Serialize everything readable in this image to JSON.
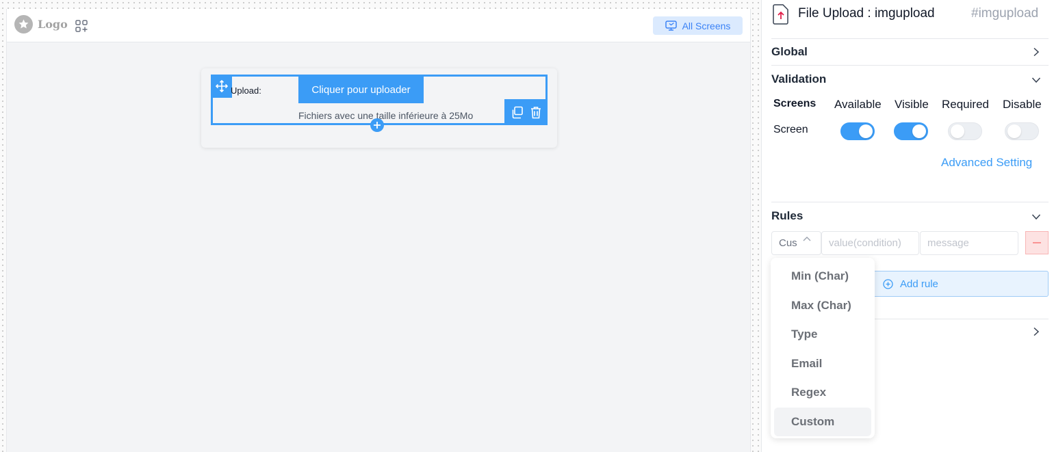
{
  "canvas": {
    "logo_text": "Logo",
    "all_screens_label": "All Screens",
    "component": {
      "label": "Upload:",
      "button_label": "Cliquer pour uploader",
      "hint": "Fichiers avec une taille inférieure à 25Mo"
    }
  },
  "panel": {
    "title": "File Upload : imgupload",
    "id": "#imgupload",
    "sections": {
      "global": "Global",
      "validation": "Validation",
      "rules": "Rules"
    },
    "validation": {
      "columns": [
        "Screens",
        "Available",
        "Visible",
        "Required",
        "Disable"
      ],
      "row_label": "Screen",
      "toggles": {
        "available": true,
        "visible": true,
        "required": false,
        "disable": false
      },
      "advanced_setting": "Advanced Setting"
    },
    "rules": {
      "selected_type": "Cus",
      "value_placeholder": "value(condition)",
      "message_placeholder": "message",
      "add_rule_label": "Add rule",
      "options": [
        "Min (Char)",
        "Max (Char)",
        "Type",
        "Email",
        "Regex",
        "Custom"
      ],
      "selected_option": "Custom"
    }
  },
  "colors": {
    "accent": "#3b9cf6",
    "danger_bg": "#fde2e2",
    "file_icon": "#e11d48"
  }
}
